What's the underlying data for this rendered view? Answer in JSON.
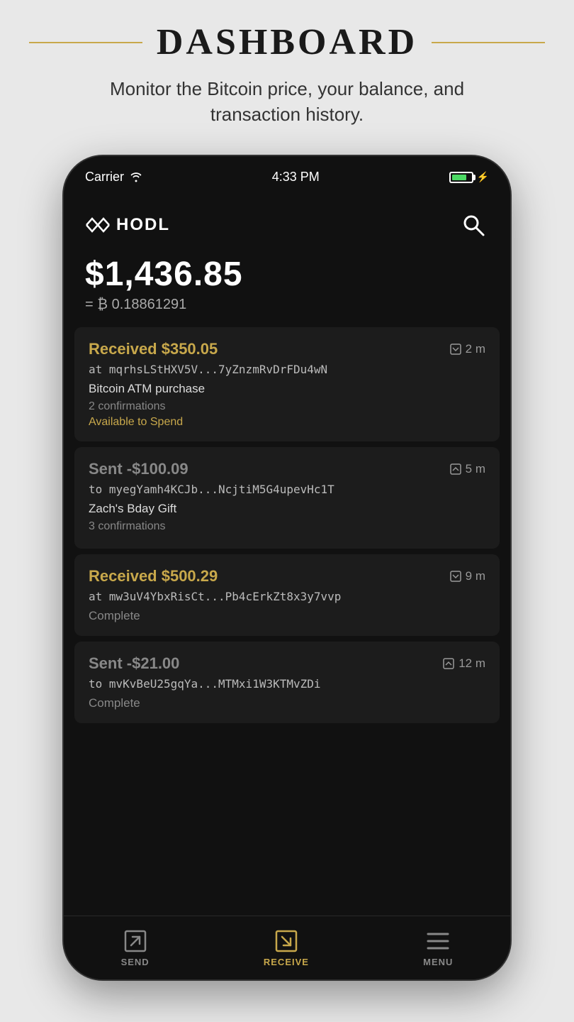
{
  "header": {
    "title": "DASHBOARD",
    "subtitle": "Monitor the Bitcoin price, your balance, and transaction history."
  },
  "status_bar": {
    "carrier": "Carrier",
    "time": "4:33 PM",
    "battery": "80"
  },
  "app": {
    "logo_text": "HODL",
    "balance_usd": "$1,436.85",
    "balance_btc": "= ₿ 0.18861291"
  },
  "transactions": [
    {
      "id": "tx1",
      "amount": "Received $350.05",
      "type": "received",
      "time": "2 m",
      "address": "at mqrhsLStHXV5V...7yZnzmRvDrFDu4wN",
      "label": "Bitcoin ATM purchase",
      "confirmations": "2 confirmations",
      "status": "Available to Spend",
      "status_type": "available"
    },
    {
      "id": "tx2",
      "amount": "Sent -$100.09",
      "type": "sent",
      "time": "5 m",
      "address": "to myegYamh4KCJb...NcjtiM5G4upevHc1T",
      "label": "Zach's Bday Gift",
      "confirmations": "3 confirmations",
      "status": "",
      "status_type": "none"
    },
    {
      "id": "tx3",
      "amount": "Received $500.29",
      "type": "received",
      "time": "9 m",
      "address": "at mw3uV4YbxRisCt...Pb4cErkZt8x3y7vvp",
      "label": "",
      "confirmations": "",
      "status": "Complete",
      "status_type": "complete"
    },
    {
      "id": "tx4",
      "amount": "Sent -$21.00",
      "type": "sent",
      "time": "12 m",
      "address": "to mvKvBeU25gqYa...MTMxi1W3KTMvZDi",
      "label": "",
      "confirmations": "",
      "status": "Complete",
      "status_type": "complete"
    }
  ],
  "bottom_nav": {
    "send_label": "SEND",
    "receive_label": "RECEIVE",
    "menu_label": "MENU"
  }
}
